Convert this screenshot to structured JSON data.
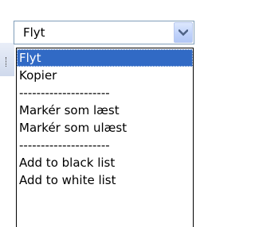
{
  "select": {
    "value": "Flyt",
    "arrow_icon": "chevron-down-icon"
  },
  "options": [
    {
      "label": "Flyt",
      "selected": true
    },
    {
      "label": "Kopier",
      "selected": false
    },
    {
      "label": "---------------------",
      "selected": false
    },
    {
      "label": "Markér som læst",
      "selected": false
    },
    {
      "label": "Markér som ulæst",
      "selected": false
    },
    {
      "label": "---------------------",
      "selected": false
    },
    {
      "label": "Add to black list",
      "selected": false
    },
    {
      "label": "Add to white list",
      "selected": false
    }
  ],
  "colors": {
    "selection": "#316ac5",
    "border": "#7f9db9",
    "arrow_button": "#c1d3fb"
  }
}
